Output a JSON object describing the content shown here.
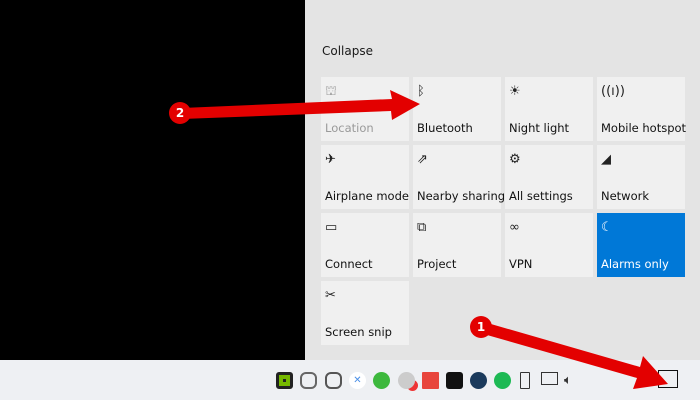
{
  "panel": {
    "collapse_label": "Collapse"
  },
  "tiles": [
    {
      "label": "Location",
      "icon": "location-icon",
      "glyph": "⛫"
    },
    {
      "label": "Bluetooth",
      "icon": "bluetooth-icon",
      "glyph": "ᛒ"
    },
    {
      "label": "Night light",
      "icon": "night-light-icon",
      "glyph": "☀"
    },
    {
      "label": "Mobile hotspot",
      "icon": "hotspot-icon",
      "glyph": "((ı))"
    },
    {
      "label": "Airplane mode",
      "icon": "airplane-icon",
      "glyph": "✈"
    },
    {
      "label": "Nearby sharing",
      "icon": "nearby-sharing-icon",
      "glyph": "⇗"
    },
    {
      "label": "All settings",
      "icon": "gear-icon",
      "glyph": "⚙"
    },
    {
      "label": "Network",
      "icon": "network-icon",
      "glyph": "◢"
    },
    {
      "label": "Connect",
      "icon": "connect-icon",
      "glyph": "▭"
    },
    {
      "label": "Project",
      "icon": "project-icon",
      "glyph": "⧉"
    },
    {
      "label": "VPN",
      "icon": "vpn-icon",
      "glyph": "∞"
    },
    {
      "label": "Alarms only",
      "icon": "moon-icon",
      "glyph": "☾"
    },
    {
      "label": "Screen snip",
      "icon": "screen-snip-icon",
      "glyph": "✂"
    }
  ],
  "annotations": {
    "step1": "1",
    "step2": "2"
  },
  "colors": {
    "accent": "#0078d7",
    "annotation": "#e30000"
  }
}
